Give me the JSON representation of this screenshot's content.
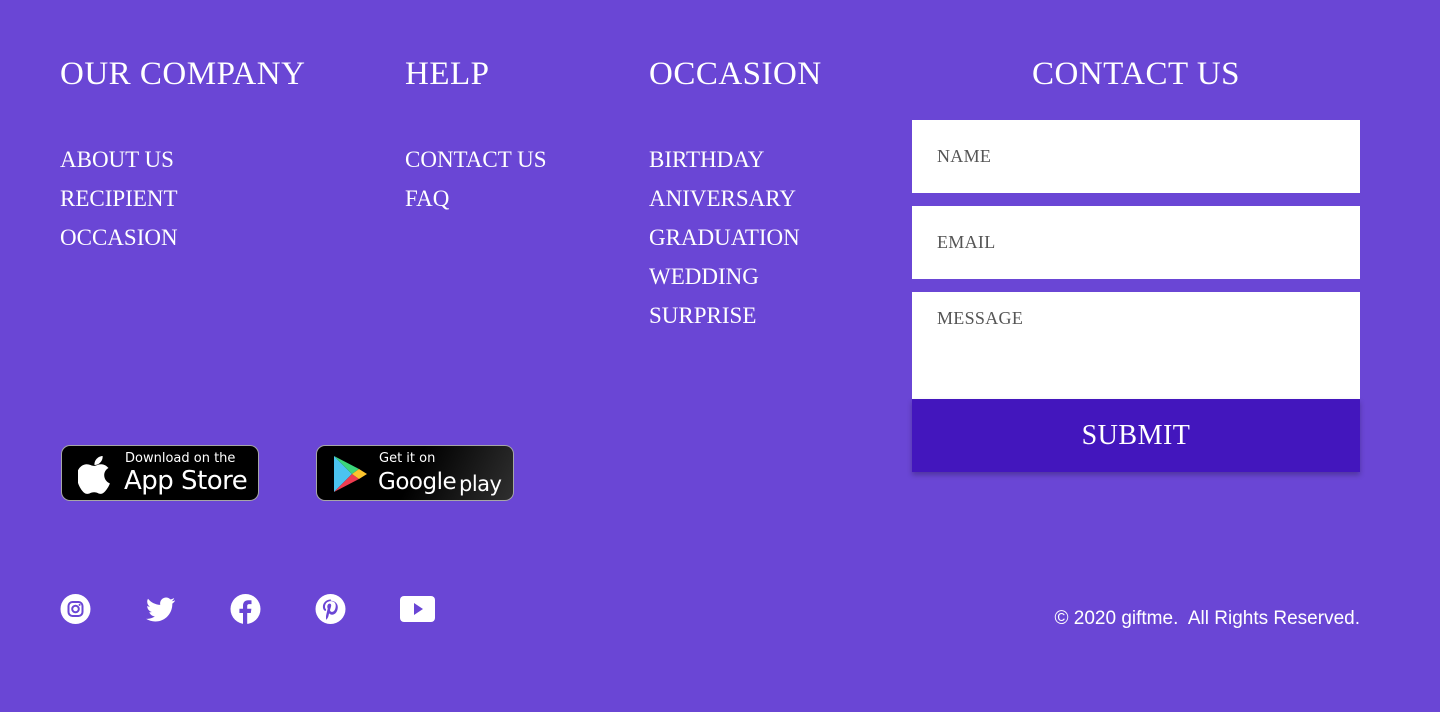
{
  "company": {
    "title": "OUR COMPANY",
    "links": [
      "ABOUT US",
      "RECIPIENT",
      "OCCASION"
    ]
  },
  "help": {
    "title": "HELP",
    "links": [
      "CONTACT US",
      "FAQ"
    ]
  },
  "occasion": {
    "title": "OCCASION",
    "links": [
      "BIRTHDAY",
      "ANIVERSARY",
      "GRADUATION",
      "WEDDING",
      "SURPRISE"
    ]
  },
  "contact": {
    "title": "CONTACT US",
    "name_placeholder": "NAME",
    "email_placeholder": "EMAIL",
    "message_placeholder": "MESSAGE",
    "submit_label": "SUBMIT"
  },
  "app_store": {
    "small": "Download on the",
    "large": "App Store",
    "icon": "apple-icon"
  },
  "google_play": {
    "small": "Get it on",
    "large_brand": "Google",
    "large_suffix": "play",
    "icon": "google-play-icon"
  },
  "social_icons": [
    "instagram-icon",
    "twitter-icon",
    "facebook-icon",
    "pinterest-icon",
    "youtube-icon"
  ],
  "copyright": "© 2020 giftme.  All Rights Reserved.",
  "colors": {
    "background": "#6a46d5",
    "submit": "#4316bd",
    "text": "#ffffff",
    "placeholder": "#555555"
  }
}
